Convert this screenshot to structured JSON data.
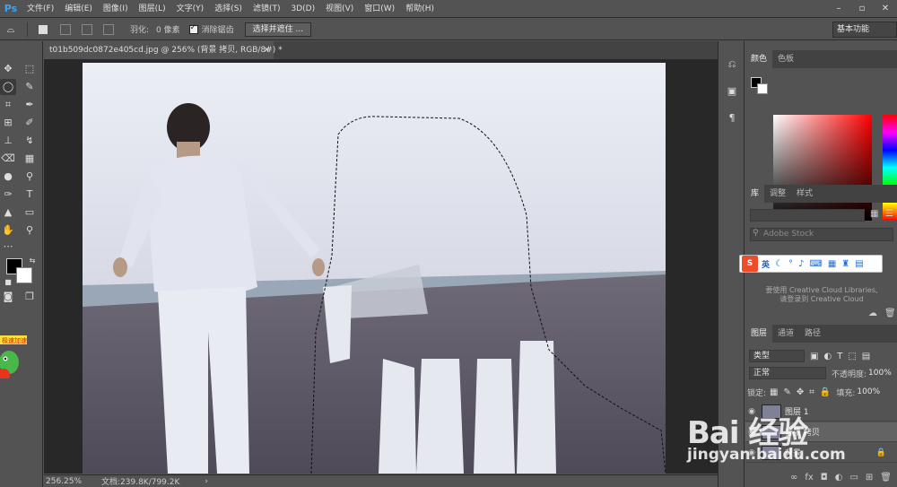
{
  "menubar": {
    "logo": "Ps",
    "items": [
      "文件(F)",
      "编辑(E)",
      "图像(I)",
      "图层(L)",
      "文字(Y)",
      "选择(S)",
      "滤镜(T)",
      "3D(D)",
      "视图(V)",
      "窗口(W)",
      "帮助(H)"
    ],
    "window_controls": [
      "–",
      "▫",
      "✕"
    ]
  },
  "options": {
    "feather_label": "羽化:",
    "feather_value": "0 像素",
    "antialias_label": "消除锯齿",
    "select_mask_label": "选择并遮住 ...",
    "workspace": "基本功能"
  },
  "document": {
    "tab_title": "t01b509dc0872e405cd.jpg @ 256% (背景 拷贝, RGB/8#) *",
    "tab_close": "×"
  },
  "status": {
    "zoom": "256.25%",
    "doc_info": "文档:239.8K/799.2K",
    "arrow": "›"
  },
  "panels": {
    "color_tabs": [
      "颜色",
      "色板"
    ],
    "library_tabs": [
      "库",
      "调整",
      "样式"
    ],
    "library_search_placeholder": "Adobe Stock",
    "library_msg1": "要使用 Creative Cloud Libraries,",
    "library_msg2": "请登录到 Creative Cloud",
    "layers_tabs": [
      "图层",
      "通道",
      "路径"
    ],
    "layer_filter": "类型",
    "blend_mode": "正常",
    "opacity_label": "不透明度:",
    "opacity_value": "100%",
    "lock_label": "锁定:",
    "fill_label": "填充:",
    "fill_value": "100%",
    "layers": [
      {
        "name": "图层 1"
      },
      {
        "name": "背景 拷贝"
      },
      {
        "name": "背景"
      }
    ]
  },
  "ime": {
    "logo": "S",
    "lang": "英"
  },
  "sticker_text": "极速加速",
  "watermark": {
    "logo": "Bai 经验",
    "url": "jingyan.baidu.com"
  }
}
